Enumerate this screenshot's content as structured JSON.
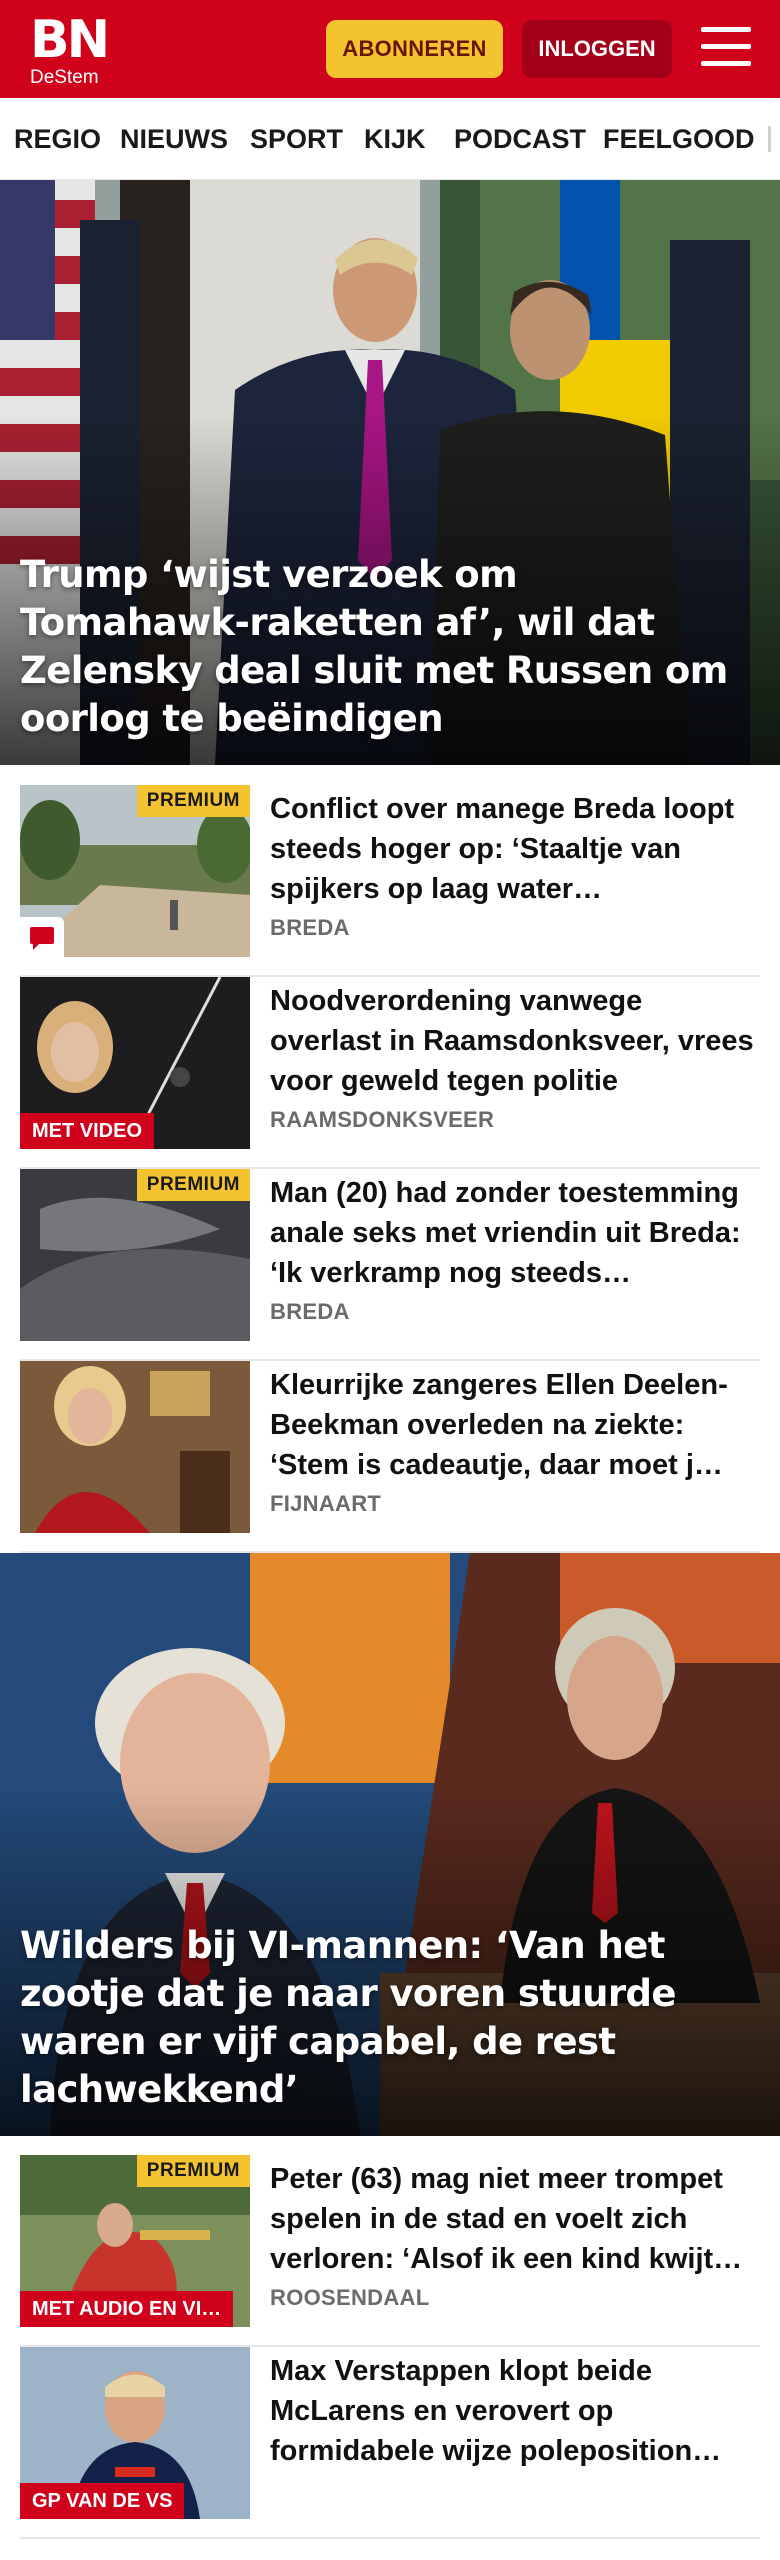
{
  "header": {
    "logo_top": "BN",
    "logo_bottom": "DeStem",
    "subscribe_label": "ABONNEREN",
    "login_label": "INLOGGEN",
    "brand_color": "#d0021b",
    "accent_color": "#f4c430",
    "menu_icon": "hamburger-menu-icon"
  },
  "nav": {
    "items": [
      "REGIO",
      "NIEUWS",
      "SPORT",
      "KIJK",
      "PODCAST",
      "FEELGOOD"
    ]
  },
  "hero1": {
    "title": "Trump ‘wijst verzoek om Tomahawk-raketten af’, wil dat Zelensky deal sluit met Russen om oorlog te beëindigen"
  },
  "articles1": [
    {
      "headline": "Conflict over manege Breda loopt steeds hoger op: ‘Staaltje van spijkers op laag water…",
      "location": "BREDA",
      "badge": "PREMIUM",
      "icon": "comment-icon"
    },
    {
      "headline": "Noodverordening vanwege overlast in Raamsdonksveer, vrees voor geweld tegen politie",
      "location": "RAAMSDONKSVEER",
      "label": "MET VIDEO"
    },
    {
      "headline": "Man (20) had zonder toestem­ming anale seks met vriendin uit Breda: ‘Ik verkramp nog steeds…",
      "location": "BREDA",
      "badge": "PREMIUM"
    },
    {
      "headline": "Kleurrijke zangeres Ellen Deelen-Beekman overleden na ziekte: ‘Stem is cadeautje, daar moet j…",
      "location": "FIJNAART"
    }
  ],
  "hero2": {
    "title": "Wilders bij VI-mannen: ‘Van het zootje dat je naar voren stuurde waren er vijf capabel, de rest lachwekkend’"
  },
  "articles2": [
    {
      "headline": "Peter (63) mag niet meer trompet spelen in de stad en voelt zich verloren: ‘Alsof ik een kind kwijt…",
      "location": "ROOSENDAAL",
      "badge": "PREMIUM",
      "label": "MET AUDIO EN VI…"
    },
    {
      "headline": "Max Verstappen klopt beide McLarens en verovert op formidabele wijze poleposition…",
      "location": "",
      "label": "GP VAN DE VS"
    }
  ]
}
